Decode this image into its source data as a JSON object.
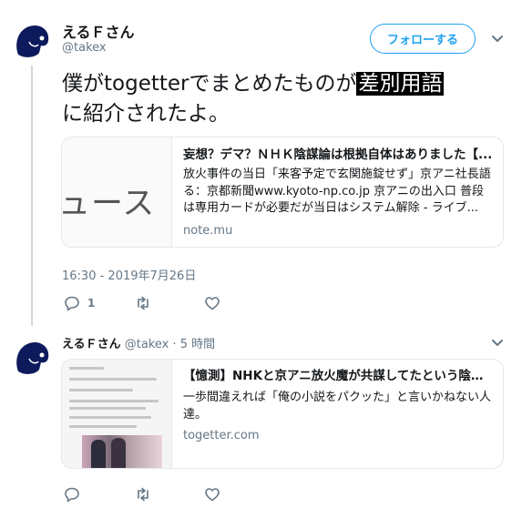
{
  "colors": {
    "accent": "#1da1f2",
    "muted": "#657786",
    "text": "#14171a",
    "border": "#e1e8ed"
  },
  "tweet": {
    "author_name": "えるＦさん",
    "author_handle": "@takex",
    "follow_label": "フォローする",
    "text_before": "僕がtogetterでまとめたものが",
    "text_highlight": "差別用語",
    "text_after": "に紹介されたよ。",
    "card": {
      "thumbnail_text": "ュース",
      "title": "妄想？デマ？ＮＨＫ陰謀論は根拠自体はありました【...",
      "description": "放火事件の当日「来客予定で玄関施錠せず」京アニ社長語る：京都新聞www.kyoto-np.co.jp 京アニの出入口 普段は専用カードが必要だが当日はシステム解除 - ライブ...",
      "domain": "note.mu"
    },
    "timestamp": "16:30 - 2019年7月26日",
    "reply_count": "1",
    "icons": {
      "reply": "reply-icon",
      "retweet": "retweet-icon",
      "like": "heart-icon",
      "more": "chevron-down-icon"
    }
  },
  "reply": {
    "author_name": "えるＦさん",
    "author_handle": "@takex",
    "separator": "·",
    "time": "5 時間",
    "card": {
      "title": "【憶測】NHKと京アニ放火魔が共謀してたという陰謀...",
      "description": "一歩間違えれば「俺の小説をパクッた」と言いかねない人達。",
      "domain": "togetter.com"
    }
  }
}
